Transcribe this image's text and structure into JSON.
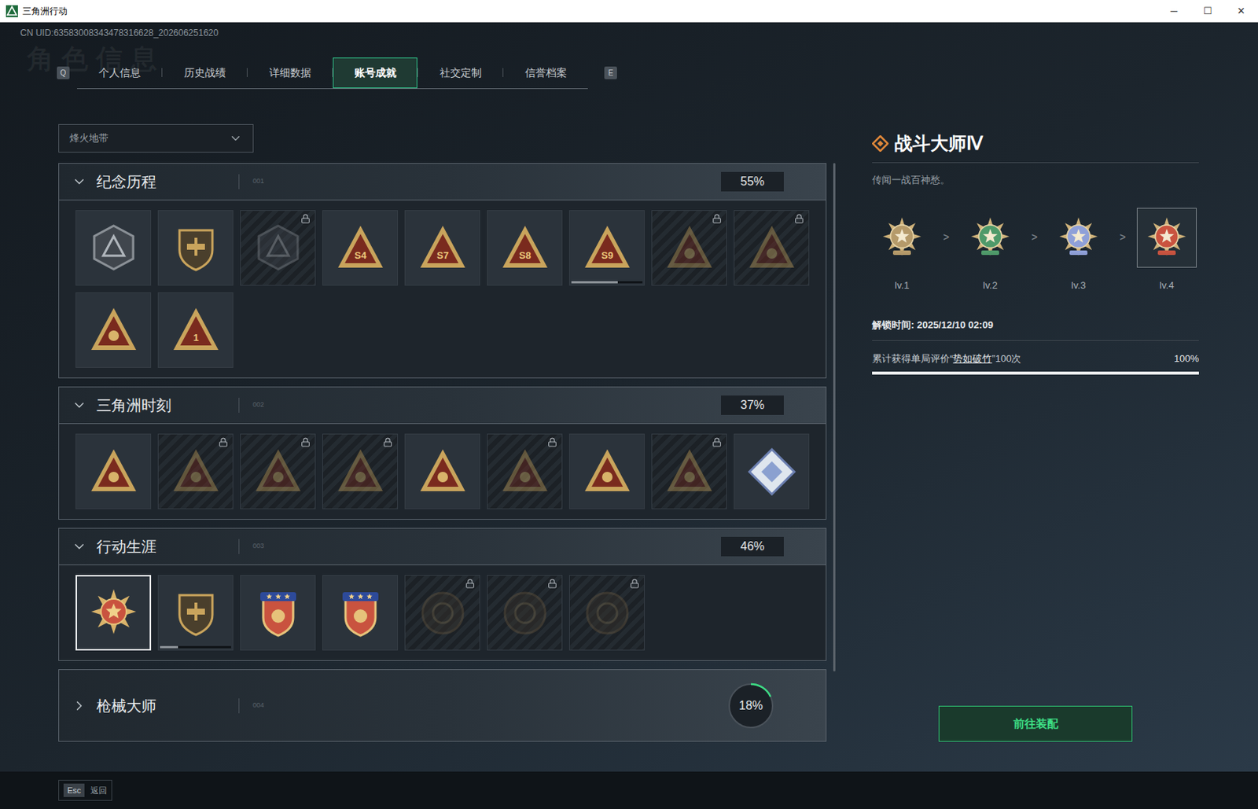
{
  "window": {
    "title": "三角洲行动",
    "controls": [
      "─",
      "☐",
      "✕"
    ]
  },
  "uid": "CN UID:63583008343478316628_202606251620",
  "watermark": "角色信息",
  "tab_keys": {
    "prev": "Q",
    "next": "E"
  },
  "tabs": [
    {
      "label": "个人信息",
      "selected": false
    },
    {
      "label": "历史战绩",
      "selected": false
    },
    {
      "label": "详细数据",
      "selected": false
    },
    {
      "label": "账号成就",
      "selected": true
    },
    {
      "label": "社交定制",
      "selected": false
    },
    {
      "label": "信誉档案",
      "selected": false
    }
  ],
  "mode_select": {
    "value": "烽火地带"
  },
  "sections": [
    {
      "title": "纪念历程",
      "code": "001",
      "percent": "55%",
      "kind": "box",
      "expanded": true,
      "badges": [
        {
          "kind": "hex",
          "locked": false,
          "selected": false
        },
        {
          "kind": "shield",
          "locked": false,
          "selected": false
        },
        {
          "kind": "hex",
          "locked": true,
          "selected": false
        },
        {
          "kind": "triangle",
          "mark": "S4",
          "locked": false,
          "selected": false
        },
        {
          "kind": "triangle",
          "mark": "S7",
          "locked": false,
          "selected": false
        },
        {
          "kind": "triangle",
          "mark": "S8",
          "locked": false,
          "selected": false
        },
        {
          "kind": "triangle",
          "mark": "S9",
          "locked": false,
          "selected": false,
          "level": 0.65
        },
        {
          "kind": "triangle",
          "locked": true,
          "selected": false
        },
        {
          "kind": "triangle",
          "locked": true,
          "selected": false
        },
        {
          "kind": "triangle",
          "locked": false,
          "selected": false
        },
        {
          "kind": "triangle",
          "mark": "1",
          "locked": false,
          "selected": false
        }
      ]
    },
    {
      "title": "三角洲时刻",
      "code": "002",
      "percent": "37%",
      "kind": "box",
      "expanded": true,
      "badges": [
        {
          "kind": "triangle",
          "locked": false,
          "selected": false
        },
        {
          "kind": "triangle",
          "locked": true,
          "selected": false
        },
        {
          "kind": "triangle",
          "locked": true,
          "selected": false
        },
        {
          "kind": "triangle",
          "locked": true,
          "selected": false
        },
        {
          "kind": "triangle",
          "locked": false,
          "selected": false
        },
        {
          "kind": "triangle",
          "locked": true,
          "selected": false
        },
        {
          "kind": "triangle",
          "locked": false,
          "selected": false
        },
        {
          "kind": "triangle",
          "locked": true,
          "selected": false
        },
        {
          "kind": "diamond",
          "locked": false,
          "selected": false
        }
      ]
    },
    {
      "title": "行动生涯",
      "code": "003",
      "percent": "46%",
      "kind": "box",
      "expanded": true,
      "badges": [
        {
          "kind": "star-medal",
          "locked": false,
          "selected": true
        },
        {
          "kind": "shield",
          "locked": false,
          "selected": false,
          "level": 0.25
        },
        {
          "kind": "crest",
          "locked": false,
          "selected": false
        },
        {
          "kind": "crest",
          "locked": false,
          "selected": false
        },
        {
          "kind": "round",
          "locked": true,
          "selected": false
        },
        {
          "kind": "round",
          "locked": true,
          "selected": false
        },
        {
          "kind": "round",
          "locked": true,
          "selected": false
        }
      ]
    },
    {
      "title": "枪械大师",
      "code": "004",
      "percent": "18%",
      "kind": "ring",
      "level": 0.18,
      "expanded": false,
      "badges": []
    }
  ],
  "detail": {
    "title": "战斗大师Ⅳ",
    "quote": "传闻一战百神愁。",
    "separator": ">",
    "levels": [
      {
        "label": "lv.1",
        "color": "#b59a6a",
        "selected": false
      },
      {
        "label": "lv.2",
        "color": "#4f9a6a",
        "selected": false
      },
      {
        "label": "lv.3",
        "color": "#8fa0d8",
        "selected": false
      },
      {
        "label": "lv.4",
        "color": "#c9533f",
        "selected": true
      }
    ],
    "unlock": "解锁时间: 2025/12/10 02:09",
    "requirement": {
      "prefix": "累计获得单局评价“",
      "highlight": "势如破竹",
      "suffix": "”100次",
      "percent": "100%",
      "level": 1
    },
    "action": "前往装配"
  },
  "footer": {
    "key": "Esc",
    "label": "返回"
  }
}
